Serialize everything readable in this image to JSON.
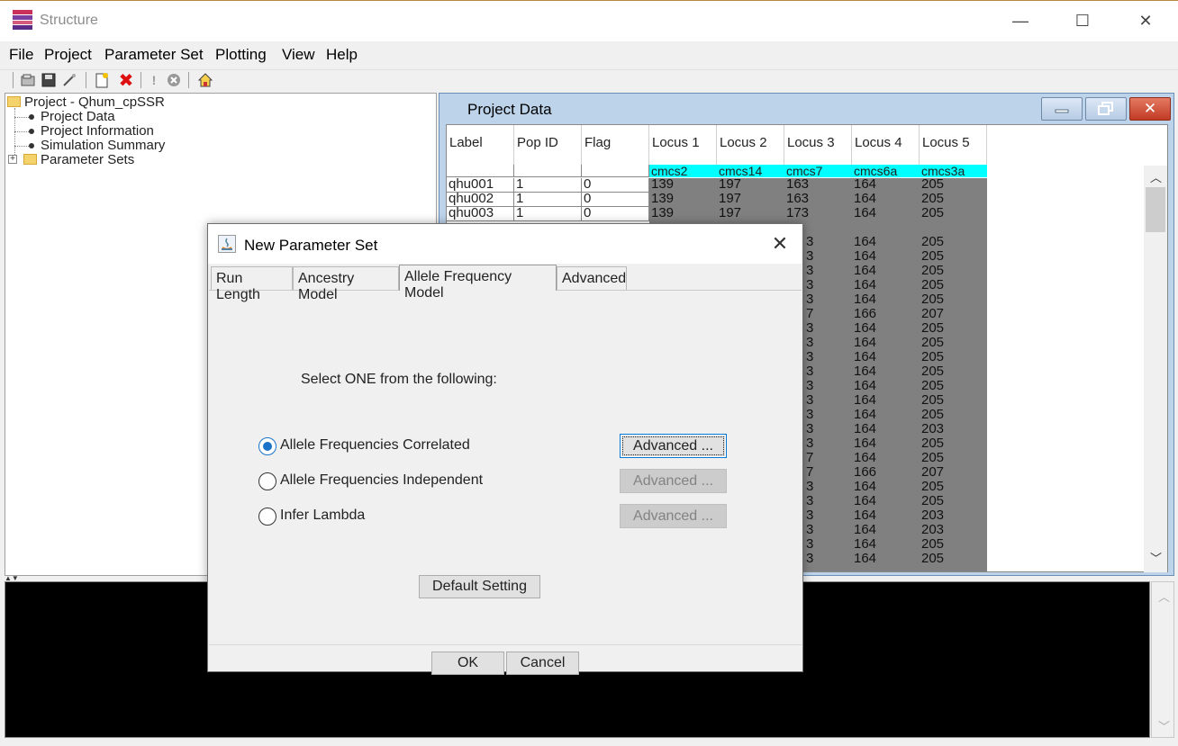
{
  "window": {
    "title": "Structure",
    "minimize_glyph": "—",
    "maximize_glyph": "☐",
    "close_glyph": "✕"
  },
  "menu": [
    "File",
    "Project",
    "Parameter Set",
    "Plotting",
    "View",
    "Help"
  ],
  "toolbar_icons": [
    "open-project-icon",
    "save-project-icon",
    "wizard-icon",
    "new-param-set-icon",
    "delete-icon",
    "run-icon",
    "stop-icon",
    "home-icon"
  ],
  "tree": {
    "root": "Project - Qhum_cpSSR",
    "children": [
      "Project Data",
      "Project Information",
      "Simulation Summary"
    ],
    "parameter_sets": "Parameter Sets"
  },
  "project_data": {
    "title": "Project Data",
    "columns": [
      "Label",
      "Pop ID",
      "Flag",
      "Locus 1",
      "Locus 2",
      "Locus 3",
      "Locus 4",
      "Locus 5"
    ],
    "locus_names": [
      "cmcs2",
      "cmcs14",
      "cmcs7",
      "cmcs6a",
      "cmcs3a"
    ],
    "rows": [
      [
        "qhu001",
        "1",
        "0",
        "139",
        "197",
        "163",
        "164",
        "205"
      ],
      [
        "qhu002",
        "1",
        "0",
        "139",
        "197",
        "163",
        "164",
        "205"
      ],
      [
        "qhu003",
        "1",
        "0",
        "139",
        "197",
        "173",
        "164",
        "205"
      ]
    ],
    "partial_rows": [
      [
        "3",
        "164",
        "205"
      ],
      [
        "3",
        "164",
        "205"
      ],
      [
        "3",
        "164",
        "205"
      ],
      [
        "3",
        "164",
        "205"
      ],
      [
        "3",
        "164",
        "205"
      ],
      [
        "7",
        "166",
        "207"
      ],
      [
        "3",
        "164",
        "205"
      ],
      [
        "3",
        "164",
        "205"
      ],
      [
        "3",
        "164",
        "205"
      ],
      [
        "3",
        "164",
        "205"
      ],
      [
        "3",
        "164",
        "205"
      ],
      [
        "3",
        "164",
        "205"
      ],
      [
        "3",
        "164",
        "205"
      ],
      [
        "3",
        "164",
        "203"
      ],
      [
        "3",
        "164",
        "205"
      ],
      [
        "7",
        "164",
        "205"
      ],
      [
        "7",
        "166",
        "207"
      ],
      [
        "3",
        "164",
        "205"
      ],
      [
        "3",
        "164",
        "205"
      ],
      [
        "3",
        "164",
        "203"
      ],
      [
        "3",
        "164",
        "203"
      ],
      [
        "3",
        "164",
        "205"
      ],
      [
        "3",
        "164",
        "205"
      ]
    ]
  },
  "dialog": {
    "title": "New Parameter Set",
    "close_glyph": "✕",
    "tabs": [
      "Run Length",
      "Ancestry Model",
      "Allele Frequency Model",
      "Advanced"
    ],
    "active_tab": "Allele Frequency Model",
    "prompt": "Select ONE from the following:",
    "options": [
      {
        "label": "Allele Frequencies Correlated",
        "selected": true,
        "advanced_label": "Advanced ...",
        "advanced_enabled": true
      },
      {
        "label": "Allele Frequencies Independent",
        "selected": false,
        "advanced_label": "Advanced ...",
        "advanced_enabled": false
      },
      {
        "label": "Infer Lambda",
        "selected": false,
        "advanced_label": "Advanced ...",
        "advanced_enabled": false
      }
    ],
    "default_button": "Default Setting",
    "ok_button": "OK",
    "cancel_button": "Cancel"
  },
  "colors": {
    "locus_name_bg": "#00ffff",
    "genotype_bg": "#808080",
    "radio_accent": "#1a73c9",
    "inner_window_frame": "#bcd3ea"
  }
}
